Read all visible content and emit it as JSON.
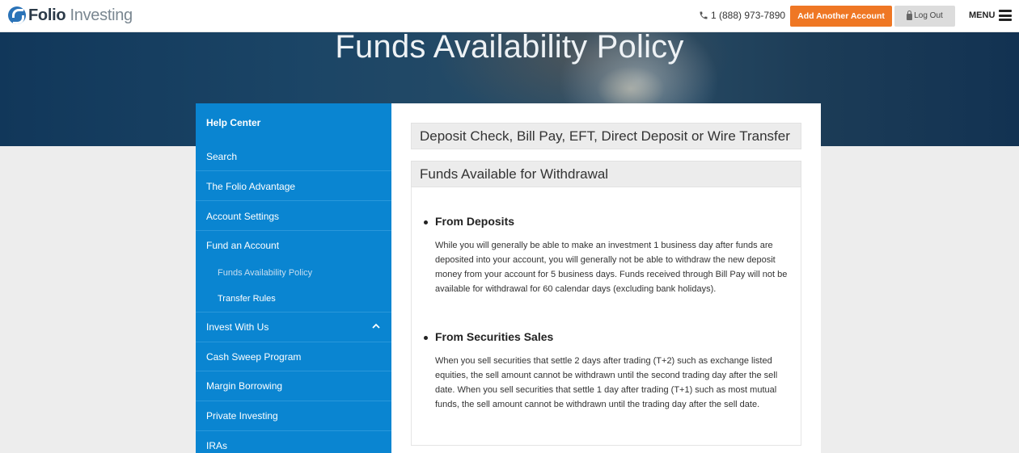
{
  "header": {
    "logo_bold": "Folio",
    "logo_light": " Investing",
    "phone": "1 (888) 973-7890",
    "add_account_label": "Add Another Account",
    "logout_label": "Log Out",
    "menu_label": "MENU"
  },
  "hero": {
    "title": "Funds Availability Policy"
  },
  "sidebar": {
    "header": "Help Center",
    "items": [
      "Search",
      "The Folio Advantage",
      "Account Settings",
      "Fund an Account"
    ],
    "subitems": [
      "Funds Availability Policy",
      "Transfer Rules"
    ],
    "items_after": [
      "Invest With Us",
      "Cash Sweep Program",
      "Margin Borrowing",
      "Private Investing",
      "IRAs"
    ]
  },
  "content": {
    "section1_title": "Deposit Check, Bill Pay, EFT, Direct Deposit or Wire Transfer",
    "section2_title": "Funds Available for Withdrawal",
    "from_deposits_title": "From Deposits",
    "from_deposits_text": "While you will generally be able to make an investment 1 business day after funds are deposited into your account, you will generally not be able to withdraw the new deposit money from your account for 5 business days. Funds received through Bill Pay will not be available for withdrawal for 60 calendar days (excluding bank holidays).",
    "from_sales_title": "From Securities Sales",
    "from_sales_text": "When you sell securities that settle 2 days after trading (T+2) such as exchange listed equities, the sell amount cannot be withdrawn until the second trading day after the sell date. When you sell securities that settle 1 day after trading (T+1) such as most mutual funds, the sell amount cannot be withdrawn until the trading day after the sell date."
  },
  "icons": {
    "logo": "folio-logo-icon",
    "phone": "phone-icon",
    "lock": "lock-icon",
    "menu": "hamburger-icon",
    "chevron": "chevron-up-icon"
  },
  "colors": {
    "accent_orange": "#ef7724",
    "sidebar_blue": "#0a85d1"
  }
}
